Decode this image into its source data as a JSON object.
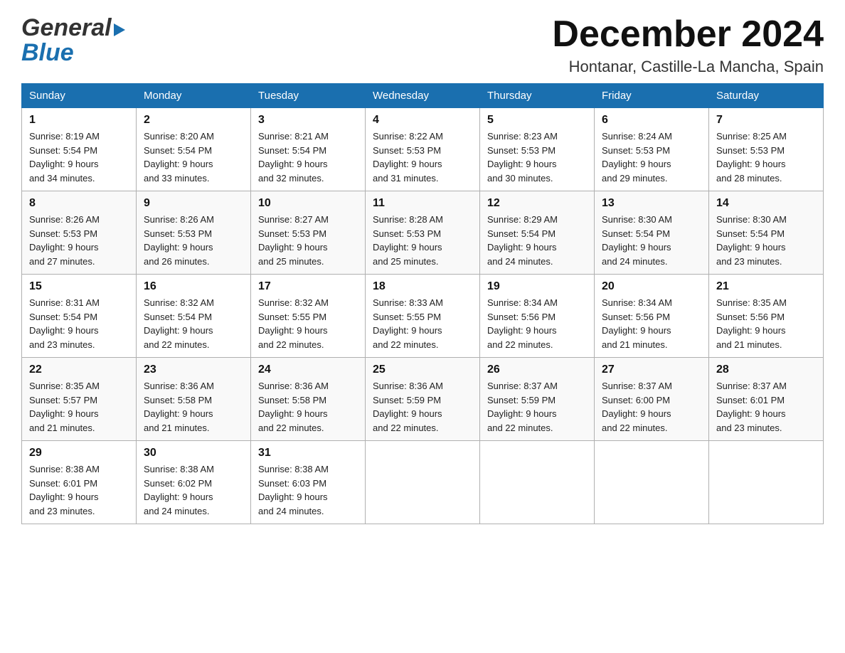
{
  "logo": {
    "line1": "General",
    "line2": "Blue"
  },
  "header": {
    "title": "December 2024",
    "subtitle": "Hontanar, Castille-La Mancha, Spain"
  },
  "weekdays": [
    "Sunday",
    "Monday",
    "Tuesday",
    "Wednesday",
    "Thursday",
    "Friday",
    "Saturday"
  ],
  "weeks": [
    [
      {
        "day": "1",
        "sunrise": "8:19 AM",
        "sunset": "5:54 PM",
        "daylight": "9 hours and 34 minutes."
      },
      {
        "day": "2",
        "sunrise": "8:20 AM",
        "sunset": "5:54 PM",
        "daylight": "9 hours and 33 minutes."
      },
      {
        "day": "3",
        "sunrise": "8:21 AM",
        "sunset": "5:54 PM",
        "daylight": "9 hours and 32 minutes."
      },
      {
        "day": "4",
        "sunrise": "8:22 AM",
        "sunset": "5:53 PM",
        "daylight": "9 hours and 31 minutes."
      },
      {
        "day": "5",
        "sunrise": "8:23 AM",
        "sunset": "5:53 PM",
        "daylight": "9 hours and 30 minutes."
      },
      {
        "day": "6",
        "sunrise": "8:24 AM",
        "sunset": "5:53 PM",
        "daylight": "9 hours and 29 minutes."
      },
      {
        "day": "7",
        "sunrise": "8:25 AM",
        "sunset": "5:53 PM",
        "daylight": "9 hours and 28 minutes."
      }
    ],
    [
      {
        "day": "8",
        "sunrise": "8:26 AM",
        "sunset": "5:53 PM",
        "daylight": "9 hours and 27 minutes."
      },
      {
        "day": "9",
        "sunrise": "8:26 AM",
        "sunset": "5:53 PM",
        "daylight": "9 hours and 26 minutes."
      },
      {
        "day": "10",
        "sunrise": "8:27 AM",
        "sunset": "5:53 PM",
        "daylight": "9 hours and 25 minutes."
      },
      {
        "day": "11",
        "sunrise": "8:28 AM",
        "sunset": "5:53 PM",
        "daylight": "9 hours and 25 minutes."
      },
      {
        "day": "12",
        "sunrise": "8:29 AM",
        "sunset": "5:54 PM",
        "daylight": "9 hours and 24 minutes."
      },
      {
        "day": "13",
        "sunrise": "8:30 AM",
        "sunset": "5:54 PM",
        "daylight": "9 hours and 24 minutes."
      },
      {
        "day": "14",
        "sunrise": "8:30 AM",
        "sunset": "5:54 PM",
        "daylight": "9 hours and 23 minutes."
      }
    ],
    [
      {
        "day": "15",
        "sunrise": "8:31 AM",
        "sunset": "5:54 PM",
        "daylight": "9 hours and 23 minutes."
      },
      {
        "day": "16",
        "sunrise": "8:32 AM",
        "sunset": "5:54 PM",
        "daylight": "9 hours and 22 minutes."
      },
      {
        "day": "17",
        "sunrise": "8:32 AM",
        "sunset": "5:55 PM",
        "daylight": "9 hours and 22 minutes."
      },
      {
        "day": "18",
        "sunrise": "8:33 AM",
        "sunset": "5:55 PM",
        "daylight": "9 hours and 22 minutes."
      },
      {
        "day": "19",
        "sunrise": "8:34 AM",
        "sunset": "5:56 PM",
        "daylight": "9 hours and 22 minutes."
      },
      {
        "day": "20",
        "sunrise": "8:34 AM",
        "sunset": "5:56 PM",
        "daylight": "9 hours and 21 minutes."
      },
      {
        "day": "21",
        "sunrise": "8:35 AM",
        "sunset": "5:56 PM",
        "daylight": "9 hours and 21 minutes."
      }
    ],
    [
      {
        "day": "22",
        "sunrise": "8:35 AM",
        "sunset": "5:57 PM",
        "daylight": "9 hours and 21 minutes."
      },
      {
        "day": "23",
        "sunrise": "8:36 AM",
        "sunset": "5:58 PM",
        "daylight": "9 hours and 21 minutes."
      },
      {
        "day": "24",
        "sunrise": "8:36 AM",
        "sunset": "5:58 PM",
        "daylight": "9 hours and 22 minutes."
      },
      {
        "day": "25",
        "sunrise": "8:36 AM",
        "sunset": "5:59 PM",
        "daylight": "9 hours and 22 minutes."
      },
      {
        "day": "26",
        "sunrise": "8:37 AM",
        "sunset": "5:59 PM",
        "daylight": "9 hours and 22 minutes."
      },
      {
        "day": "27",
        "sunrise": "8:37 AM",
        "sunset": "6:00 PM",
        "daylight": "9 hours and 22 minutes."
      },
      {
        "day": "28",
        "sunrise": "8:37 AM",
        "sunset": "6:01 PM",
        "daylight": "9 hours and 23 minutes."
      }
    ],
    [
      {
        "day": "29",
        "sunrise": "8:38 AM",
        "sunset": "6:01 PM",
        "daylight": "9 hours and 23 minutes."
      },
      {
        "day": "30",
        "sunrise": "8:38 AM",
        "sunset": "6:02 PM",
        "daylight": "9 hours and 24 minutes."
      },
      {
        "day": "31",
        "sunrise": "8:38 AM",
        "sunset": "6:03 PM",
        "daylight": "9 hours and 24 minutes."
      },
      null,
      null,
      null,
      null
    ]
  ],
  "labels": {
    "sunrise": "Sunrise:",
    "sunset": "Sunset:",
    "daylight": "Daylight:"
  }
}
